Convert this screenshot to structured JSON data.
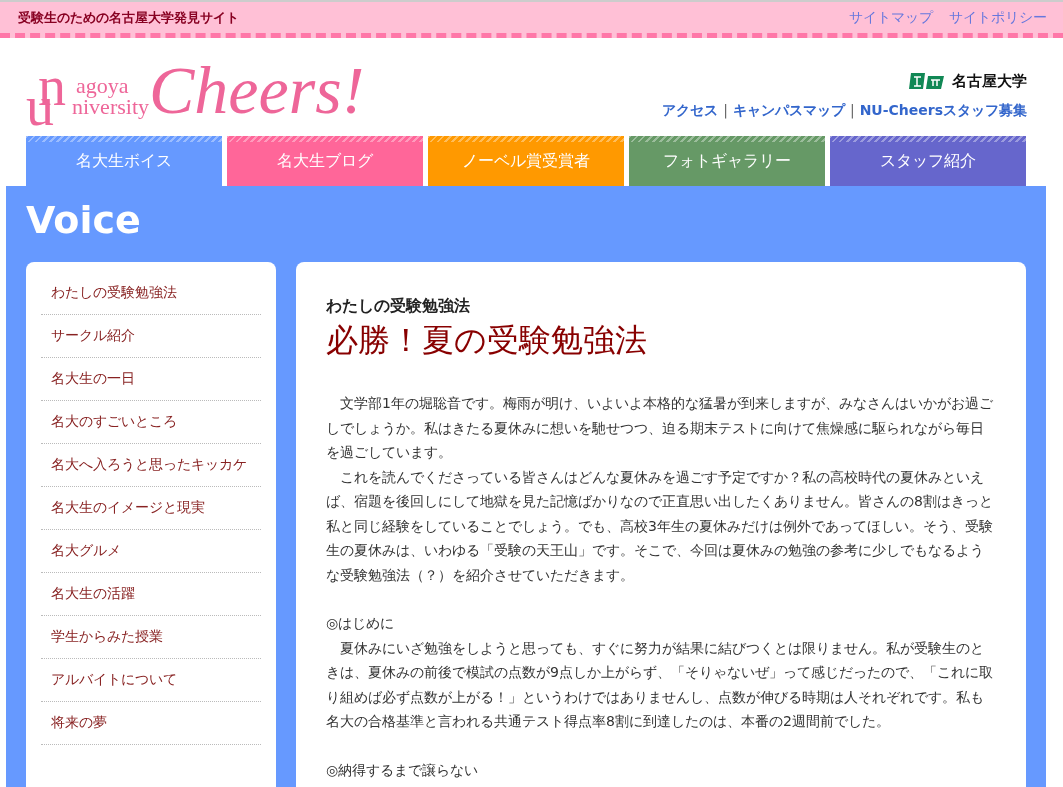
{
  "top_bar": {
    "tagline": "受験生のための名古屋大学発見サイト",
    "links": [
      "サイトマップ",
      "サイトポリシー"
    ]
  },
  "header": {
    "logo": {
      "mark_n": "n",
      "mark_u": "u",
      "line1": "agoya",
      "line2": "niversity",
      "title": "Cheers!"
    },
    "university": "名古屋大学",
    "separator": "|",
    "links": [
      "アクセス",
      "キャンパスマップ",
      "NU-Cheersスタッフ募集"
    ]
  },
  "tabs": [
    {
      "label": "名大生ボイス",
      "color": "#6699ff"
    },
    {
      "label": "名大生ブログ",
      "color": "#ff6699"
    },
    {
      "label": "ノーベル賞受賞者",
      "color": "#ff9900"
    },
    {
      "label": "フォトギャラリー",
      "color": "#669966"
    },
    {
      "label": "スタッフ紹介",
      "color": "#6666cc"
    }
  ],
  "section_title": "Voice",
  "sidebar": {
    "items": [
      "わたしの受験勉強法",
      "サークル紹介",
      "名大生の一日",
      "名大のすごいところ",
      "名大へ入ろうと思ったキッカケ",
      "名大生のイメージと現実",
      "名大グルメ",
      "名大生の活躍",
      "学生からみた授業",
      "アルバイトについて",
      "将来の夢"
    ]
  },
  "article": {
    "category": "わたしの受験勉強法",
    "title": "必勝！夏の受験勉強法",
    "blocks": [
      {
        "kind": "paragraph",
        "text": "文学部1年の堀聡音です。梅雨が明け、いよいよ本格的な猛暑が到来しますが、みなさんはいかがお過ごしでしょうか。私はきたる夏休みに想いを馳せつつ、迫る期末テストに向けて焦燥感に駆られながら毎日を過ごしています。"
      },
      {
        "kind": "paragraph",
        "text": "これを読んでくださっている皆さんはどんな夏休みを過ごす予定ですか？私の高校時代の夏休みといえば、宿題を後回しにして地獄を見た記憶ばかりなので正直思い出したくありません。皆さんの8割はきっと私と同じ経験をしていることでしょう。でも、高校3年生の夏休みだけは例外であってほしい。そう、受験生の夏休みは、いわゆる「受験の天王山」です。そこで、今回は夏休みの勉強の参考に少しでもなるような受験勉強法（？）を紹介させていただきます。"
      },
      {
        "kind": "heading",
        "text": "◎はじめに"
      },
      {
        "kind": "paragraph",
        "text": "夏休みにいざ勉強をしようと思っても、すぐに努力が結果に結びつくとは限りません。私が受験生のときは、夏休みの前後で模試の点数が9点しか上がらず、「そりゃないぜ」って感じだったので、「これに取り組めば必ず点数が上がる！」というわけではありませんし、点数が伸びる時期は人それぞれです。私も名大の合格基準と言われる共通テスト得点率8割に到達したのは、本番の2週間前でした。"
      },
      {
        "kind": "heading",
        "text": "◎納得するまで譲らない"
      }
    ]
  }
}
